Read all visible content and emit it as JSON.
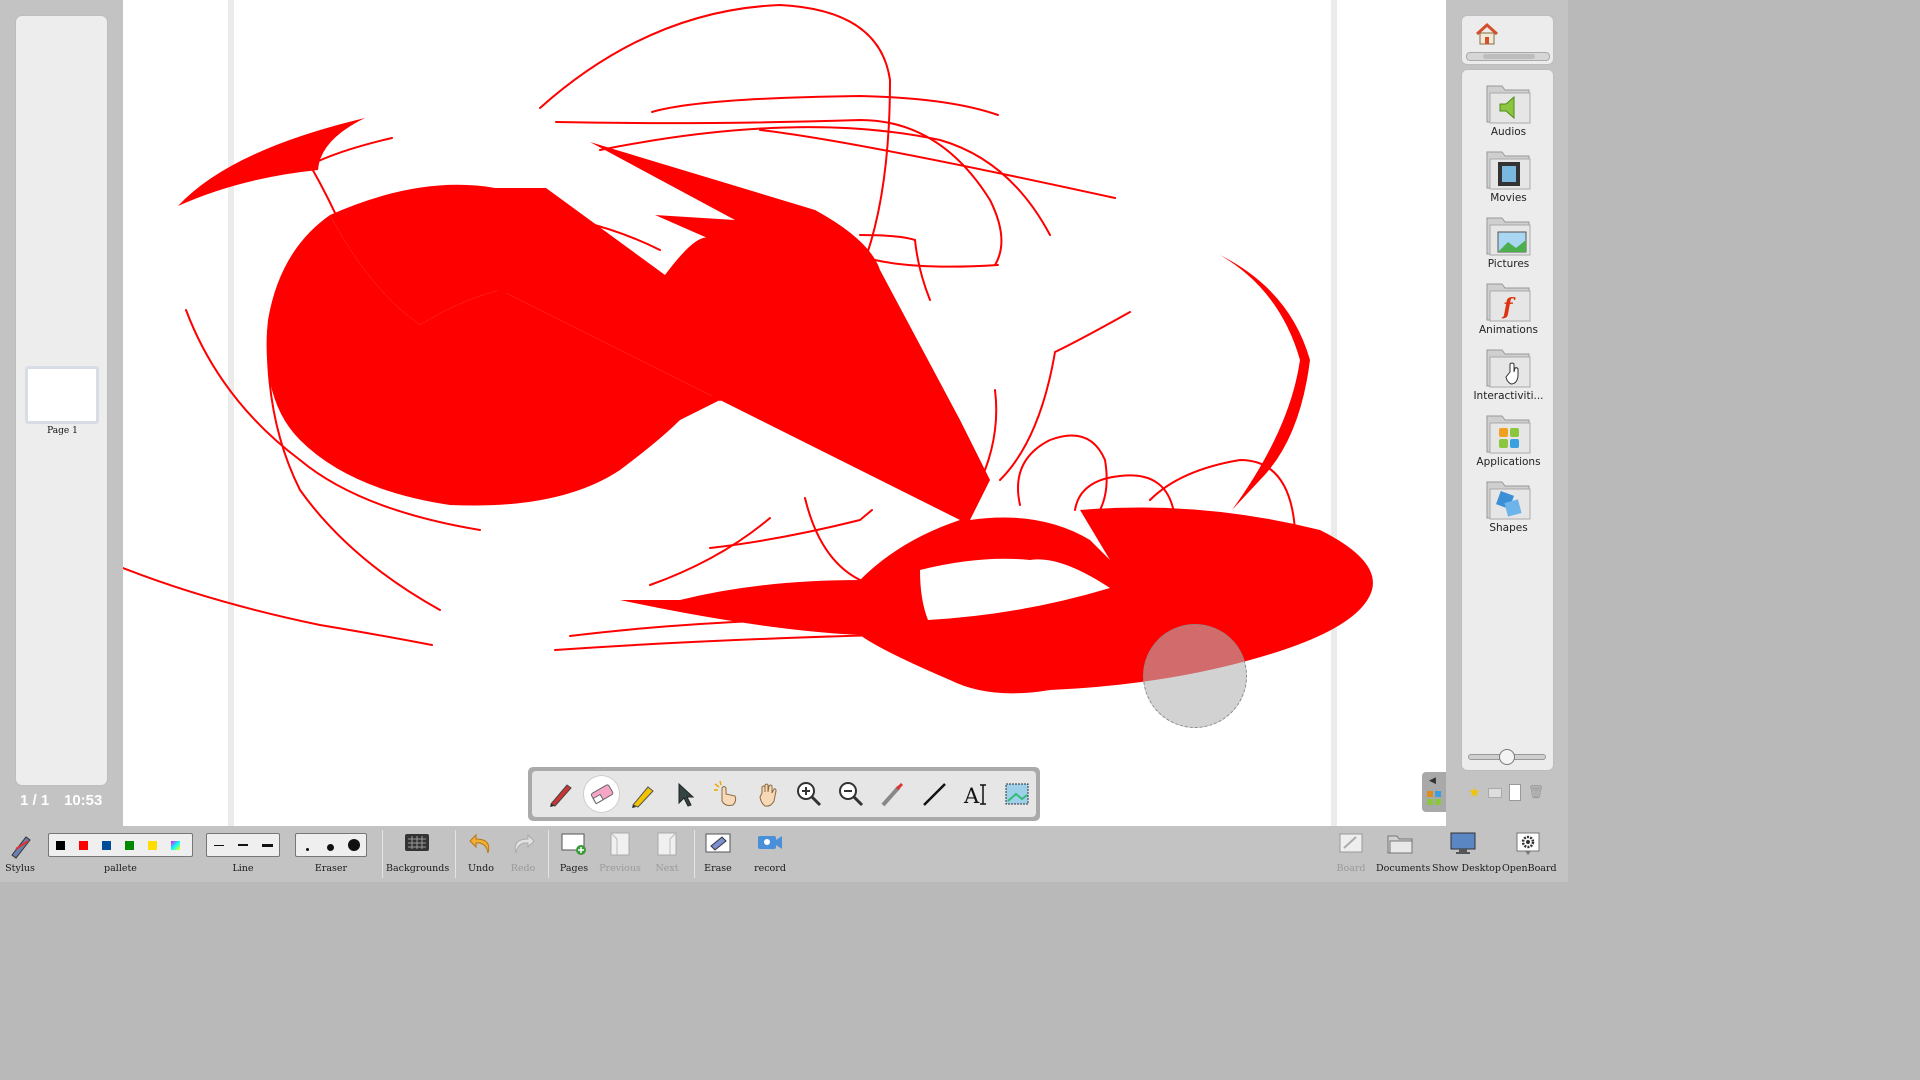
{
  "left_panel": {
    "page_thumb_label": "Page 1",
    "page_counter": "1 / 1",
    "clock": "10:53"
  },
  "board": {
    "stroke_color": "#ff0000",
    "background": "#ffffff"
  },
  "floating_toolbar": {
    "tools": [
      "pen-icon",
      "eraser-icon",
      "marker-icon",
      "selector-icon",
      "play-icon",
      "hand-icon",
      "zoom-in-icon",
      "zoom-out-icon",
      "laser-pointer-icon",
      "line-icon",
      "text-icon",
      "capture-icon"
    ],
    "active_tool": "eraser-icon"
  },
  "library": {
    "items": [
      {
        "label": "Audios"
      },
      {
        "label": "Movies"
      },
      {
        "label": "Pictures"
      },
      {
        "label": "Animations"
      },
      {
        "label": "Interactiviti..."
      },
      {
        "label": "Applications"
      },
      {
        "label": "Shapes"
      }
    ]
  },
  "bottom_toolbar": {
    "stylus": "Stylus",
    "pallete": "pallete",
    "line": "Line",
    "eraser": "Eraser",
    "backgrounds": "Backgrounds",
    "undo": "Undo",
    "redo": "Redo",
    "pages": "Pages",
    "previous": "Previous",
    "next": "Next",
    "erase": "Erase",
    "record": "record",
    "board": "Board",
    "documents": "Documents",
    "show_desktop": "Show Desktop",
    "openboard": "OpenBoard",
    "palette_colors": [
      "#000000",
      "#ff0000",
      "#004c99",
      "#008800",
      "#ffdd00"
    ]
  }
}
